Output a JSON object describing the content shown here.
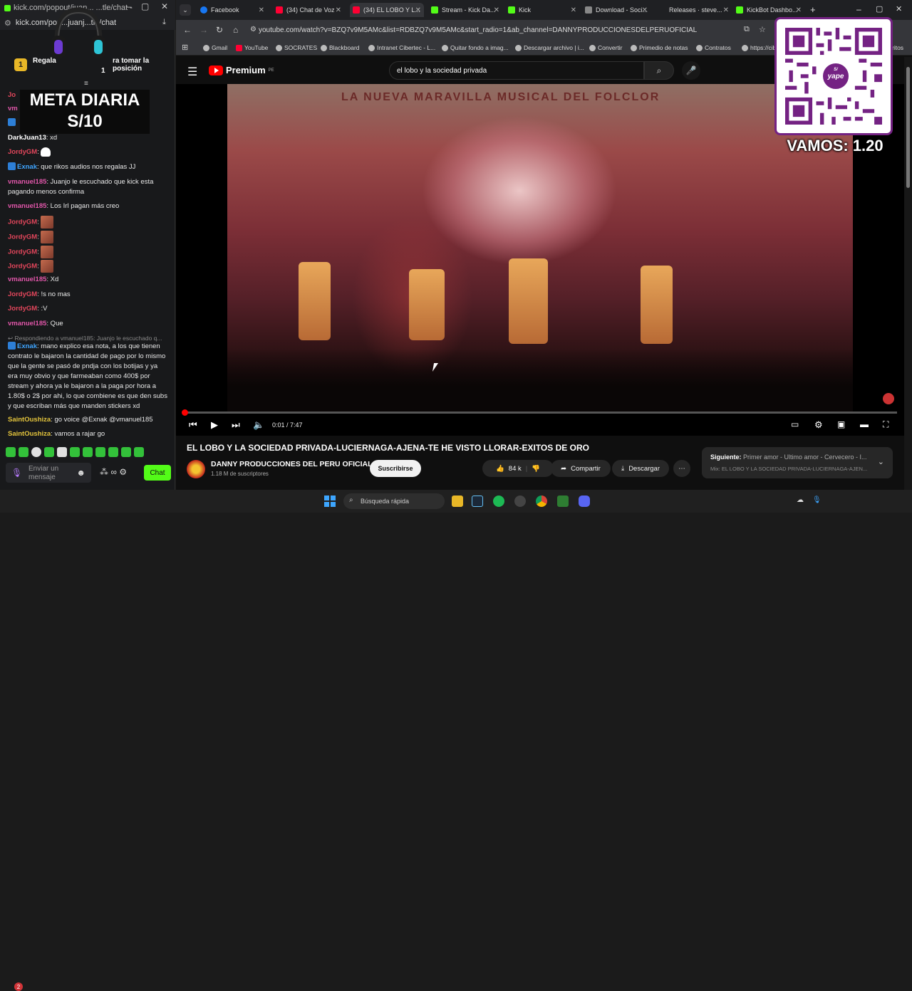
{
  "left_window": {
    "tab_title": "kick.com/popout/juan... ...tle/chat -",
    "url": "kick.com/pop...juanj...tle/chat",
    "pinned": {
      "coin": "1",
      "text_start": "Regala",
      "text_end": "ra tomar la posición",
      "text_sub": "1"
    },
    "overlay": {
      "meta_line1": "META DIARIA",
      "meta_line2": "S/10"
    },
    "messages": [
      {
        "user": "DarkJuan13",
        "text": ": xd"
      },
      {
        "user": "JordyGM",
        "text": ":"
      },
      {
        "user": "Exnak",
        "text": ": que rikos audios nos regalas JJ"
      },
      {
        "user": "vmanuel185",
        "text": ": Juanjo le escuchado que kick esta pagando menos confirma"
      },
      {
        "user": "vmanuel185",
        "text": ": Los Irl pagan más creo"
      },
      {
        "user": "JordyGM",
        "text": ":"
      },
      {
        "user": "JordyGM",
        "text": ":"
      },
      {
        "user": "JordyGM",
        "text": ":"
      },
      {
        "user": "JordyGM",
        "text": ":"
      },
      {
        "user": "vmanuel185",
        "text": ": Xd"
      },
      {
        "user": "JordyGM",
        "text": ": !s no mas"
      },
      {
        "user": "JordyGM",
        "text": ": :V"
      },
      {
        "user": "vmanuel185",
        "text": ": Que"
      },
      {
        "reply": "Respondiendo a vmanuel185: Juanjo le escuchado q..."
      },
      {
        "user": "Exnak",
        "text": ": mano explico esa nota, a los que tienen contrato le bajaron la cantidad de pago por lo mismo que la gente se pasó de pndja con los botijas y ya era muy obvio y que farmeaban como 400$ por stream y ahora ya le bajaron a la paga por hora a 1.80$ o 2$ por ahi, lo que combiene es que den subs y que escriban más que manden stickers xd"
      },
      {
        "user": "SaintOushiza",
        "text": ": go voice @Exnak @vmanuel185"
      },
      {
        "user": "SaintOushiza",
        "text": ": vamos a rajar go"
      }
    ],
    "input_placeholder_1": "Enviar un",
    "input_placeholder_2": "mensaje",
    "chat_button": "Chat"
  },
  "browser": {
    "tabs": [
      {
        "label": "Facebook",
        "color": "#1877f2"
      },
      {
        "label": "(34) Chat de Voz",
        "color": "#ff0033"
      },
      {
        "label": "(34) EL LOBO Y L...",
        "color": "#ff0033"
      },
      {
        "label": "Stream - Kick Da...",
        "color": "#53fc18"
      },
      {
        "label": "Kick",
        "color": "#53fc18"
      },
      {
        "label": "Download - Soci...",
        "color": "#888888"
      },
      {
        "label": "Releases · steve...",
        "color": "#222222"
      },
      {
        "label": "KickBot Dashbo...",
        "color": "#53fc18"
      }
    ],
    "url": "youtube.com/watch?v=BZQ7v9M5AMc&list=RDBZQ7v9M5AMc&start_radio=1&ab_channel=DANNYPRODUCCIONESDELPERUOFICIAL",
    "bookmarks": [
      "Gmail",
      "YouTube",
      "SOCRATES",
      "Blackboard",
      "Intranet Cibertec - L...",
      "Quitar fondo a imag...",
      "Descargar archivo | i...",
      "Convertir",
      "Primedio de notas",
      "Contratos",
      "https://cib"
    ],
    "bookmarks_tail": "ritos"
  },
  "youtube": {
    "logo": "Premium",
    "logo_region": "PE",
    "search_query": "el lobo y la sociedad privada",
    "video_banner": "LA NUEVA MARAVILLA MUSICAL DEL FOLCLOR",
    "time": "0:01 / 7:47",
    "progress_fraction": 0.0021,
    "title": "EL LOBO Y LA SOCIEDAD PRIVADA-LUCIERNAGA-AJENA-TE HE VISTO LLORAR-EXITOS DE ORO",
    "channel": "DANNY PRODUCCIONES DEL PERU OFICIAL",
    "subscribers": "1.18 M de suscriptores",
    "subscribe": "Suscribirse",
    "likes": "84 k",
    "share": "Compartir",
    "download": "Descargar",
    "up_next_label": "Siguiente:",
    "up_next_title": "Primer amor - Ultimo amor - Cervecero - I...",
    "up_next_mix": "Mix: EL LOBO Y LA SOCIEDAD PRIVADA-LUCIERNAGA-AJEN..."
  },
  "qr_overlay": {
    "badge": "yape",
    "badge_top": "S/",
    "vamos": "VAMOS: 1.20"
  },
  "taskbar": {
    "search_placeholder": "Búsqueda rápida",
    "notification_count": "2"
  }
}
